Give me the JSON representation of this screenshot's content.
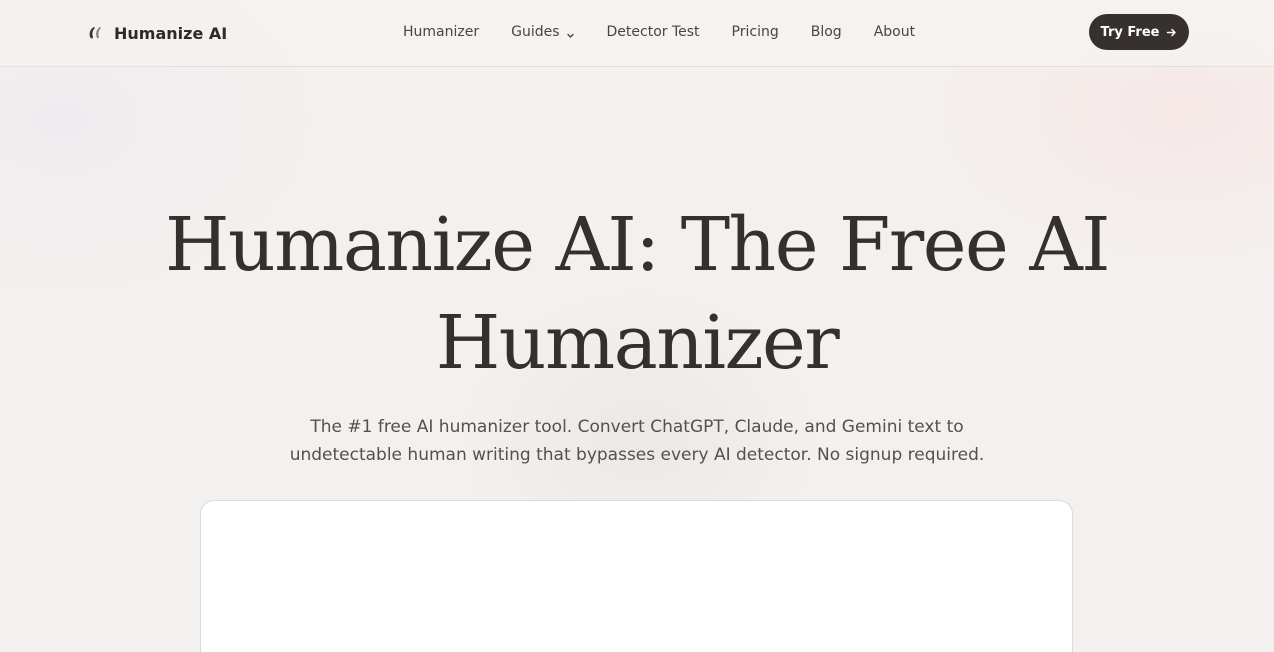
{
  "brand": {
    "name": "Humanize AI",
    "logo_icon": "double-quote-logo-icon"
  },
  "nav": {
    "items": [
      {
        "label": "Humanizer"
      },
      {
        "label": "Guides",
        "has_dropdown": true,
        "dropdown_icon": "chevron-down-icon"
      },
      {
        "label": "Detector Test"
      },
      {
        "label": "Pricing"
      },
      {
        "label": "Blog"
      },
      {
        "label": "About"
      }
    ]
  },
  "cta": {
    "label": "Try Free",
    "icon": "arrow-right-icon",
    "bg_color": "#36302e",
    "text_color": "#ffffff"
  },
  "hero": {
    "title_line1": "Humanize AI: The Free AI",
    "title_line2": "Humanizer",
    "subtitle_line1": "The #1 free AI humanizer tool. Convert ChatGPT, Claude, and Gemini text to",
    "subtitle_line2": "undetectable human writing that bypasses every AI detector. No signup required."
  },
  "colors": {
    "page_bg": "#f3f1ef",
    "text_primary": "#34302e",
    "text_secondary": "#55504d",
    "card_bg": "#ffffff"
  }
}
